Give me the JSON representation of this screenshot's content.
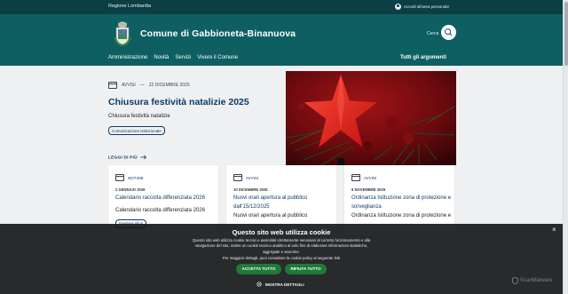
{
  "topbar": {
    "region": "Regione Lombardia",
    "login": "Accedi all'area personale"
  },
  "header": {
    "site_name": "Comune di Gabbioneta-Binanuova",
    "search_label": "Cerca",
    "nav": [
      "Amministrazione",
      "Novità",
      "Servizi",
      "Vivere il Comune"
    ],
    "all_topics": "Tutti gli argomenti"
  },
  "hero": {
    "category": "AVVISI",
    "separator": "—",
    "date": "22 DICEMBRE 2025",
    "title": "Chiusura festività natalizie 2025",
    "description": "Chiusura festività natalizie",
    "tag": "Comunicazione istituzionale",
    "read_more": "LEGGI DI PIÙ"
  },
  "cards": [
    {
      "category": "NOTIZIE",
      "date": "2 GENNAIO 2026",
      "title": "Calendario raccolta differenziata 2026",
      "description": "Calendario raccolta differenziata 2026",
      "tag": "Gestione rifiuti"
    },
    {
      "category": "AVVISI",
      "date": "10 DICEMBRE 2025",
      "title": "Nuovi orari apertura al pubblico dall'15/12/2025",
      "description": "Nuovi orari apertura al pubblico"
    },
    {
      "category": "AVVISI",
      "date": "6 NOVEMBRE 2025",
      "title": "Ordinanza Istituzione zona di protezione e sorveglianza",
      "description": "Ordinanza Istituzione zona di protezione e"
    }
  ],
  "cookie": {
    "title": "Questo sito web utilizza cookie",
    "body": "Questo sito web utilizza cookie tecnici e assimilati strettamente necessari al corretto funzionamento e alla navigazione del sito, inoltre un cookie tecnico analitico al solo fine di elaborare informazioni statistiche, aggregate e anonime.",
    "more": "Per maggiori dettagli, puoi consultare la cookie policy al seguente link",
    "accept": "ACCETTA TUTTO",
    "reject": "RIFIUTA TUTTO",
    "details": "MOSTRA DETTAGLI",
    "close": "×"
  },
  "watermark": "ScanMalware",
  "colors": {
    "topbar": "#0b3f44",
    "header": "#0e5f62",
    "link": "#0e3a66",
    "cookie_button": "#1e7a35"
  }
}
